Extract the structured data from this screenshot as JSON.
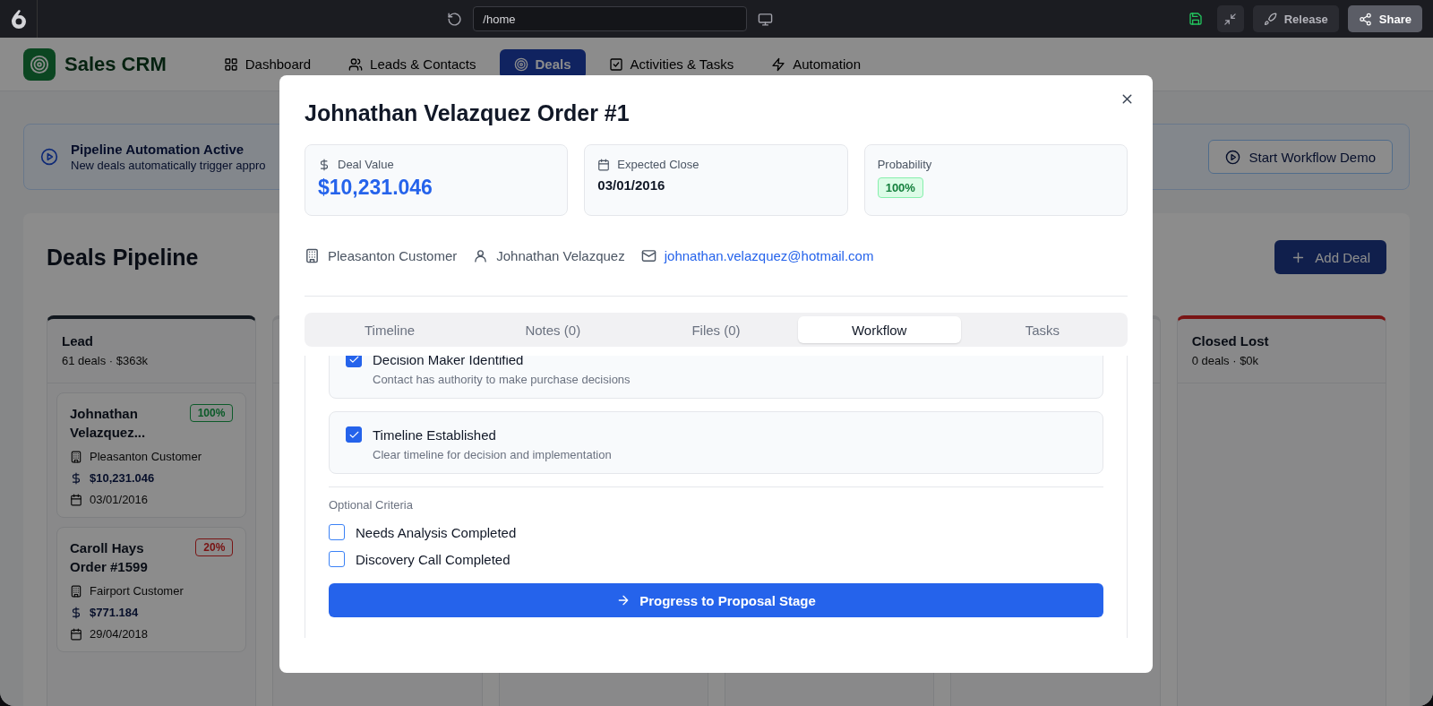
{
  "topbar": {
    "url": "/home",
    "buttons": [
      {
        "kind": "release",
        "label": "Release"
      },
      {
        "kind": "share",
        "label": "Share"
      }
    ]
  },
  "app": {
    "title": "Sales CRM",
    "nav": [
      {
        "kind": "grid",
        "label": "Dashboard",
        "selected": false
      },
      {
        "kind": "people",
        "label": "Leads & Contacts",
        "selected": false
      },
      {
        "kind": "target",
        "label": "Deals",
        "selected": true
      },
      {
        "kind": "check",
        "label": "Activities & Tasks",
        "selected": false
      },
      {
        "kind": "bolt",
        "label": "Automation",
        "selected": false
      }
    ]
  },
  "banner": {
    "title": "Pipeline Automation Active",
    "text": "New deals automatically trigger appro",
    "button": "Start Workflow Demo"
  },
  "pipeline": {
    "title": "Deals Pipeline",
    "add_button": "Add Deal",
    "columns": [
      {
        "kind": "stage",
        "title": "Lead",
        "summary": "61 deals · $363k",
        "color": "#11171e",
        "cards": [
          {
            "title": "Johnathan Velazquez...",
            "badge": "100%",
            "color": "#0c5a29",
            "company": "Pleasanton Customer",
            "value": "$10,231.046",
            "date": "03/01/2016"
          },
          {
            "title": "Caroll Hays Order #1599",
            "badge": "20%",
            "color": "#791515",
            "company": "Fairport Customer",
            "value": "$771.184",
            "date": "29/04/2018"
          }
        ]
      },
      {
        "kind": "covered"
      },
      {
        "kind": "covered"
      },
      {
        "kind": "covered"
      },
      {
        "kind": "covered"
      },
      {
        "kind": "stage",
        "title": "Closed Lost",
        "summary": "0 deals · $0k",
        "color": "#791515"
      }
    ]
  },
  "modal": {
    "title": "Johnathan Velazquez Order #1",
    "stats": [
      {
        "kind": "money",
        "label": "Deal Value",
        "value": "$10,231.046"
      },
      {
        "kind": "date",
        "label": "Expected Close",
        "value": "03/01/2016"
      },
      {
        "kind": "badge",
        "label": "Probability",
        "value": "100%"
      }
    ],
    "company": "Pleasanton Customer",
    "contact": "Johnathan Velazquez",
    "email": "johnathan.velazquez@hotmail.com",
    "tabs": [
      {
        "label": "Timeline",
        "selected": false
      },
      {
        "label": "Notes (0)",
        "selected": false
      },
      {
        "label": "Files (0)",
        "selected": false
      },
      {
        "label": "Workflow",
        "selected": true
      },
      {
        "label": "Tasks",
        "selected": false
      }
    ],
    "required": [
      {
        "title": "Decision Maker Identified",
        "description": "Contact has authority to make purchase decisions",
        "checked": true
      },
      {
        "title": "Timeline Established",
        "description": "Clear timeline for decision and implementation",
        "checked": true
      }
    ],
    "optional_title": "Optional Criteria",
    "optional": [
      {
        "label": "Needs Analysis Completed",
        "checked": false
      },
      {
        "label": "Discovery Call Completed",
        "checked": false
      }
    ],
    "action": "Progress to Proposal Stage"
  }
}
